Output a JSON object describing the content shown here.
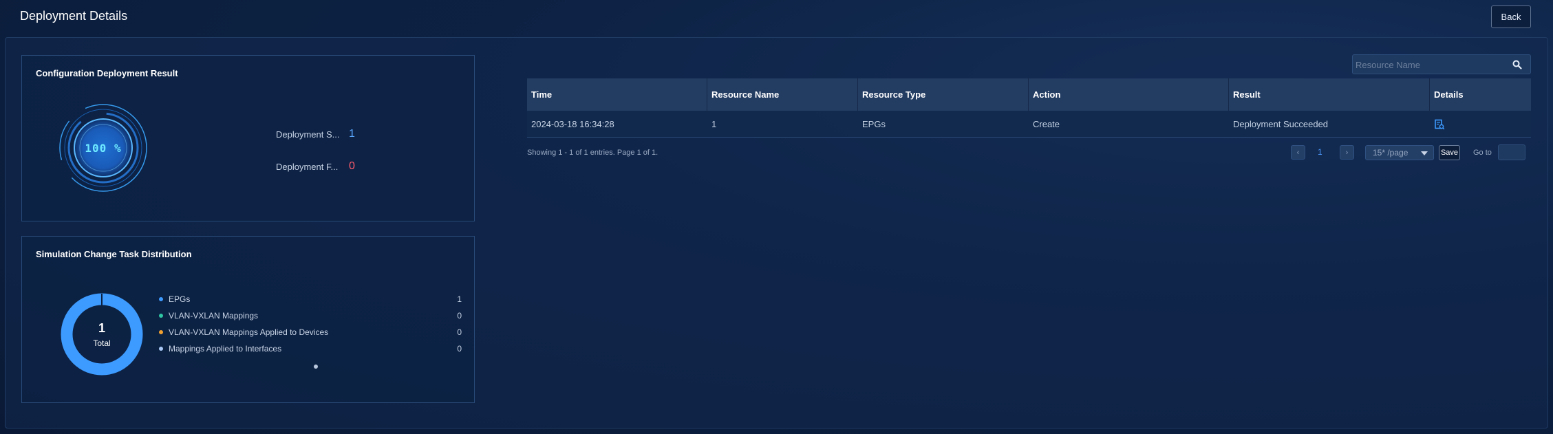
{
  "header": {
    "title": "Deployment Details",
    "back_label": "Back"
  },
  "deployment_card": {
    "title": "Configuration Deployment Result",
    "gauge_text": "100 %",
    "success_label": "Deployment S...",
    "success_value": "1",
    "failed_label": "Deployment F...",
    "failed_value": "0",
    "colors": {
      "success": "#5aa7ff",
      "failed": "#ff5c6c",
      "gauge": "#6ee9ff"
    }
  },
  "distribution_card": {
    "title": "Simulation Change Task Distribution",
    "total_value": "1",
    "total_label": "Total",
    "items": [
      {
        "label": "EPGs",
        "value": "1",
        "color": "#3d9bff"
      },
      {
        "label": "VLAN-VXLAN Mappings",
        "value": "0",
        "color": "#2fc6a3"
      },
      {
        "label": "VLAN-VXLAN Mappings Applied to Devices",
        "value": "0",
        "color": "#f0a030"
      },
      {
        "label": "Mappings Applied to Interfaces",
        "value": "0",
        "color": "#a9c8f5"
      }
    ]
  },
  "search": {
    "placeholder": "Resource Name",
    "icon": "search-icon"
  },
  "table": {
    "columns": [
      "Time",
      "Resource Name",
      "Resource Type",
      "Action",
      "Result",
      "Details"
    ],
    "rows": [
      {
        "time": "2024-03-18 16:34:28",
        "resource_name": "1",
        "resource_type": "EPGs",
        "action": "Create",
        "result": "Deployment Succeeded",
        "details_icon": "details-icon"
      }
    ]
  },
  "pagination": {
    "info": "Showing 1 - 1 of 1 entries. Page 1 of 1.",
    "prev_icon": "‹",
    "next_icon": "›",
    "current_page": "1",
    "page_size": "15* /page",
    "save_label": "Save",
    "goto_label": "Go to",
    "goto_value": ""
  }
}
